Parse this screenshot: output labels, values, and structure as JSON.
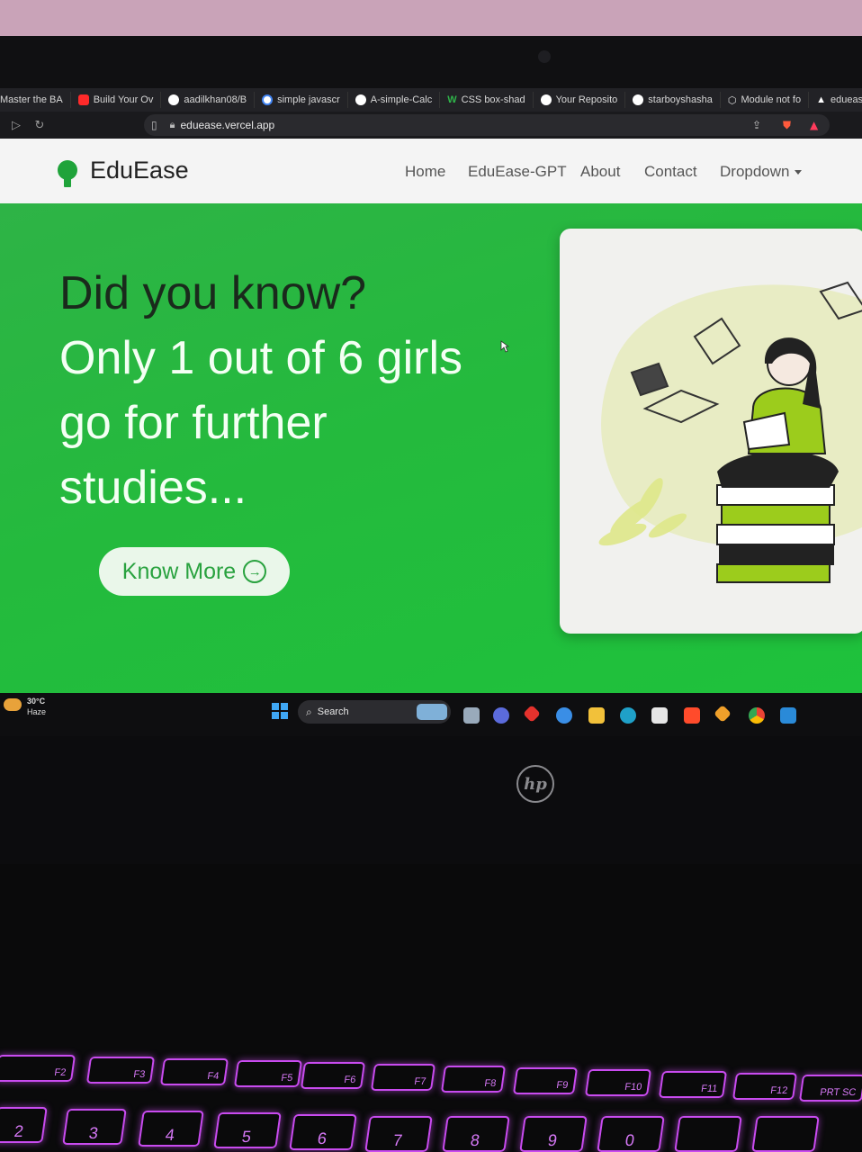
{
  "browser": {
    "bookmarks": [
      {
        "label": "Master the BA",
        "icon": "bookmark-icon",
        "color": "#cccccc"
      },
      {
        "label": "Build Your Ov",
        "icon": "youtube-icon",
        "color": "#ff2a2a"
      },
      {
        "label": "aadilkhan08/B",
        "icon": "github-icon",
        "color": "#ffffff"
      },
      {
        "label": "simple javascr",
        "icon": "google-icon",
        "color": "#4285f4"
      },
      {
        "label": "A-simple-Calc",
        "icon": "github-icon",
        "color": "#ffffff"
      },
      {
        "label": "CSS box-shad",
        "icon": "w3-icon",
        "color": "#2fb54a"
      },
      {
        "label": "Your Reposito",
        "icon": "github-icon",
        "color": "#ffffff"
      },
      {
        "label": "starboyshasha",
        "icon": "github-icon",
        "color": "#ffffff"
      },
      {
        "label": "Module not fo",
        "icon": "cube-icon",
        "color": "#dddddd"
      },
      {
        "label": "eduease – De",
        "icon": "vercel-icon",
        "color": "#ffffff"
      }
    ],
    "url": "eduease.vercel.app"
  },
  "site": {
    "brand": "EduEase",
    "nav": [
      "Home",
      "EduEase-GPT",
      "About",
      "Contact",
      "Dropdown"
    ],
    "headline_line1": "Did you know?",
    "headline_line2": "Only 1 out of 6 girls",
    "headline_line3": "go for further",
    "headline_line4": "studies...",
    "cta": "Know More",
    "colors": {
      "hero_green": "#24ba3d",
      "brand_green": "#1fa33a"
    }
  },
  "taskbar": {
    "temperature": "30°C",
    "weather": "Haze",
    "search_label": "Search",
    "apps": [
      "file-explorer-icon",
      "edge-icon",
      "store-icon",
      "brave-icon",
      "git-icon",
      "chrome-icon",
      "vscode-icon"
    ]
  },
  "laptop": {
    "brand": "hp",
    "fn_keys": [
      "F2",
      "F3",
      "F4",
      "F5",
      "F6",
      "F7",
      "F8",
      "F9",
      "F10",
      "F11",
      "F12",
      "PRT SC"
    ],
    "number_keys": [
      "2",
      "3",
      "4",
      "5",
      "6",
      "7",
      "8",
      "9",
      "0"
    ]
  }
}
